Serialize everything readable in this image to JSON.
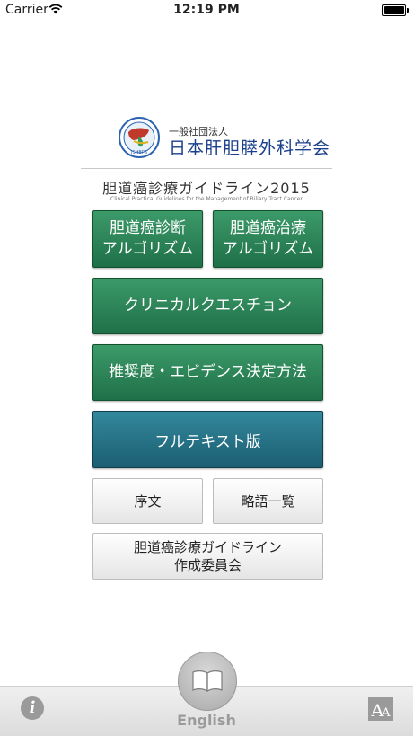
{
  "status_bar": {
    "carrier": "Carrier",
    "time": "12:19 PM"
  },
  "header": {
    "org_small": "一般社団法人",
    "org_main": "日本肝胆膵外科学会",
    "logo_text": "JSHBPS",
    "guide_title": "胆道癌診療ガイドライン2015",
    "guide_subtitle": "Clinical Practical Guidelines for the Management of Biliary Tract Cancer"
  },
  "menu": {
    "diagnosis_algo": {
      "line1": "胆道癌診断",
      "line2": "アルゴリズム"
    },
    "treatment_algo": {
      "line1": "胆道癌治療",
      "line2": "アルゴリズム"
    },
    "clinical_question": "クリニカルクエスチョン",
    "recommendation": "推奨度・エビデンス決定方法",
    "fulltext": "フルテキスト版",
    "preface": "序文",
    "abbreviations": "略語一覧",
    "committee": {
      "line1": "胆道癌診療ガイドライン",
      "line2": "作成委員会"
    }
  },
  "bottom_bar": {
    "info_glyph": "i",
    "english_label": "English",
    "font_glyph_big": "A",
    "font_glyph_small": "A"
  },
  "colors": {
    "green": "#2a8458",
    "teal": "#26768a",
    "org_blue": "#1a3f8b"
  }
}
